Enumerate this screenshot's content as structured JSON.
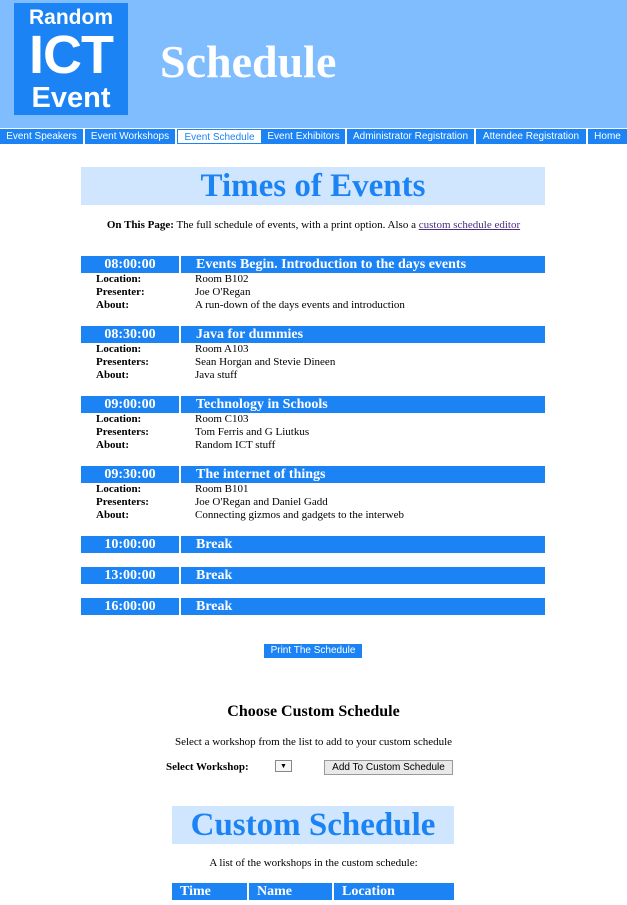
{
  "logo": {
    "line1": "Random",
    "line2": "ICT",
    "line3": "Event"
  },
  "site_title": "Schedule",
  "nav": [
    {
      "label": "Event Speakers"
    },
    {
      "label": "Event Workshops"
    },
    {
      "label": "Event Schedule",
      "active": true
    },
    {
      "label": "Event Exhibitors"
    },
    {
      "label": "Administrator Registration"
    },
    {
      "label": "Attendee Registration"
    },
    {
      "label": "Home"
    }
  ],
  "page_heading": "Times of Events",
  "on_page": {
    "label": "On This Page:",
    "text": "The full schedule of events, with a print option. Also a",
    "link": "custom schedule editor"
  },
  "events": [
    {
      "time": "08:00:00",
      "title": "Events Begin. Introduction to the days events",
      "details": [
        {
          "label": "Location:",
          "value": "Room B102"
        },
        {
          "label": "Presenter:",
          "value": "Joe O'Regan"
        },
        {
          "label": "About:",
          "value": "A run-down of the days events and introduction"
        }
      ]
    },
    {
      "time": "08:30:00",
      "title": "Java for dummies",
      "details": [
        {
          "label": "Location:",
          "value": "Room A103"
        },
        {
          "label": "Presenters:",
          "value": "Sean Horgan and Stevie Dineen"
        },
        {
          "label": "About:",
          "value": "Java stuff"
        }
      ]
    },
    {
      "time": "09:00:00",
      "title": "Technology in Schools",
      "details": [
        {
          "label": "Location:",
          "value": "Room C103"
        },
        {
          "label": "Presenters:",
          "value": "Tom Ferris and G Liutkus"
        },
        {
          "label": "About:",
          "value": "Random ICT stuff"
        }
      ]
    },
    {
      "time": "09:30:00",
      "title": "The internet of things",
      "details": [
        {
          "label": "Location:",
          "value": "Room B101"
        },
        {
          "label": "Presenters:",
          "value": "Joe O'Regan and Daniel Gadd"
        },
        {
          "label": "About:",
          "value": "Connecting gizmos and gadgets to the interweb"
        }
      ]
    },
    {
      "time": "10:00:00",
      "title": "Break",
      "details": []
    },
    {
      "time": "13:00:00",
      "title": "Break",
      "details": []
    },
    {
      "time": "16:00:00",
      "title": "Break",
      "details": []
    }
  ],
  "print_button": "Print The Schedule",
  "custom": {
    "heading": "Choose Custom Schedule",
    "subtext": "Select a workshop from the list to add to your custom schedule",
    "select_label": "Select Workshop:",
    "select_glyph": "▼",
    "add_button": "Add To Custom Schedule",
    "title": "Custom Schedule",
    "description": "A list of the workshops in the custom schedule:",
    "table_headers": [
      "Time",
      "Name",
      "Location"
    ]
  },
  "colors": {
    "brand": "#1c83f5",
    "header_bg": "#80bdff",
    "heading_bg": "#d0e6ff"
  }
}
